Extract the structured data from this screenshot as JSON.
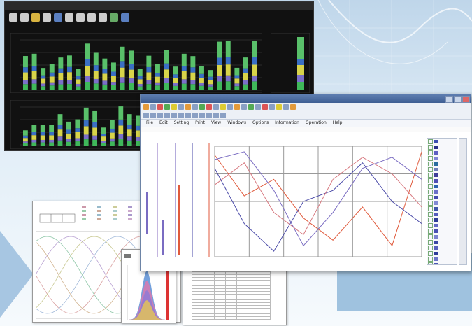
{
  "background": {
    "accent": "#9fc2df",
    "arrow_color": "#a7c6e2"
  },
  "dark_window": {
    "title": "",
    "toolbar_icons": [
      "home-icon",
      "home-icon",
      "chart-icon",
      "home-icon",
      "monitor-icon",
      "window-icon",
      "grid-icon",
      "window-icon",
      "table-icon",
      "back-icon",
      "forward-icon"
    ],
    "series_colors": [
      "#3fb85a",
      "#7b6fc9",
      "#d8d44a",
      "#3a6fc4",
      "#59c06a"
    ]
  },
  "app_window": {
    "title": "",
    "menu": [
      "File",
      "Edit",
      "Setting",
      "Print",
      "View",
      "Windows",
      "Options",
      "Information",
      "Operation",
      "Help"
    ],
    "x_axis_label": "",
    "legend": {
      "colors": [
        "#3a4fb0",
        "#27308a",
        "#5d5fc2",
        "#7f85d6",
        "#2a6d9e",
        "#6c7fb9",
        "#3f3f99",
        "#5050b5",
        "#2d63b0",
        "#6a71c9",
        "#424bb1",
        "#8089d3",
        "#3d55a9",
        "#545cbc",
        "#2c3c96",
        "#6068c4",
        "#4850b3",
        "#7a82d0",
        "#3a47a5",
        "#5760be",
        "#2e3b98",
        "#6b74c8",
        "#4954b2"
      ]
    },
    "series": [
      {
        "color": "#e05a3c"
      },
      {
        "color": "#7a6cc2"
      },
      {
        "color": "#4a4aa8"
      },
      {
        "color": "#d7787f"
      }
    ]
  },
  "report_wave": {
    "logo_text": ""
  },
  "report_table": {
    "title": ""
  }
}
